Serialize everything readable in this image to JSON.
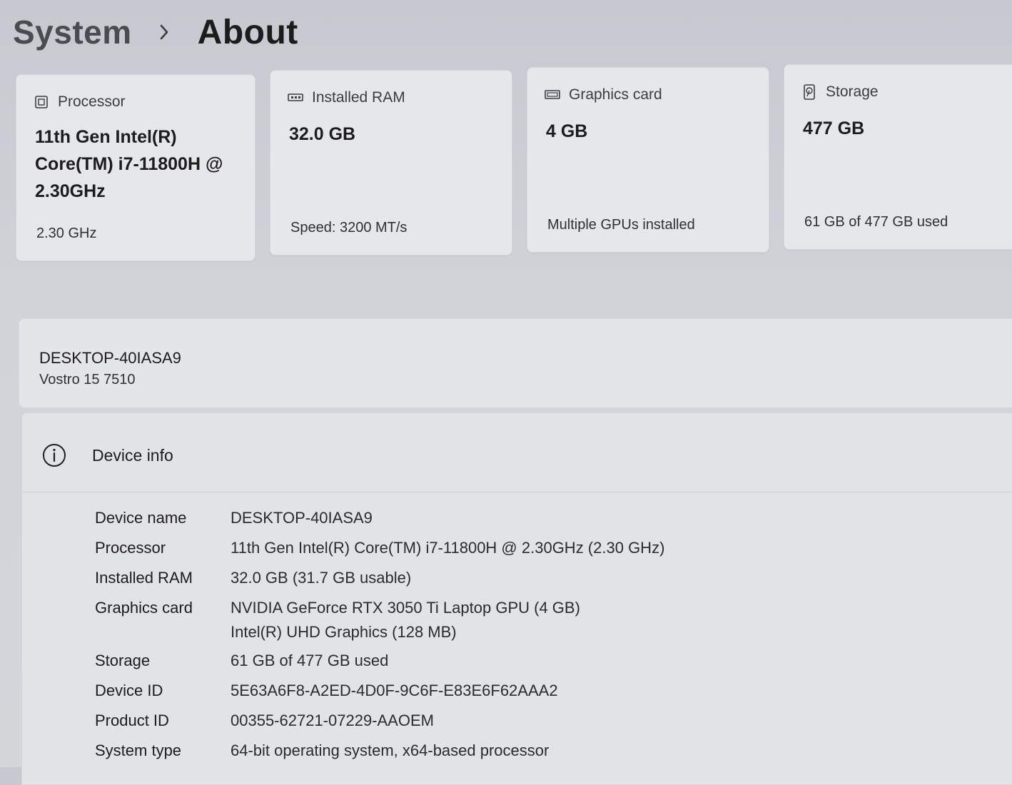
{
  "breadcrumb": {
    "parent": "System",
    "current": "About"
  },
  "cards": {
    "processor": {
      "title": "Processor",
      "value": "11th Gen Intel(R) Core(TM) i7-11800H @ 2.30GHz",
      "sub": "2.30 GHz",
      "icon": "processor-icon"
    },
    "ram": {
      "title": "Installed RAM",
      "value": "32.0 GB",
      "sub": "Speed: 3200 MT/s",
      "icon": "ram-icon"
    },
    "graphics": {
      "title": "Graphics card",
      "value": "4 GB",
      "sub": "Multiple GPUs installed",
      "icon": "graphics-card-icon"
    },
    "storage": {
      "title": "Storage",
      "value": "477 GB",
      "sub": "61 GB of 477 GB used",
      "icon": "storage-icon"
    }
  },
  "device": {
    "name": "DESKTOP-40IASA9",
    "model": "Vostro 15 7510"
  },
  "device_info": {
    "title": "Device info",
    "icon": "info-icon",
    "rows": [
      {
        "label": "Device name",
        "value": "DESKTOP-40IASA9"
      },
      {
        "label": "Processor",
        "value": "11th Gen Intel(R) Core(TM) i7-11800H @ 2.30GHz (2.30 GHz)"
      },
      {
        "label": "Installed RAM",
        "value": "32.0 GB (31.7 GB usable)"
      },
      {
        "label": "Graphics card",
        "value": "NVIDIA GeForce RTX 3050 Ti Laptop GPU (4 GB)",
        "value2": "Intel(R) UHD Graphics (128 MB)"
      },
      {
        "label": "Storage",
        "value": "61 GB of 477 GB used"
      },
      {
        "label": "Device ID",
        "value": "5E63A6F8-A2ED-4D0F-9C6F-E83E6F62AAA2"
      },
      {
        "label": "Product ID",
        "value": "00355-62721-07229-AAOEM"
      },
      {
        "label": "System type",
        "value": "64-bit operating system, x64-based processor"
      }
    ]
  }
}
